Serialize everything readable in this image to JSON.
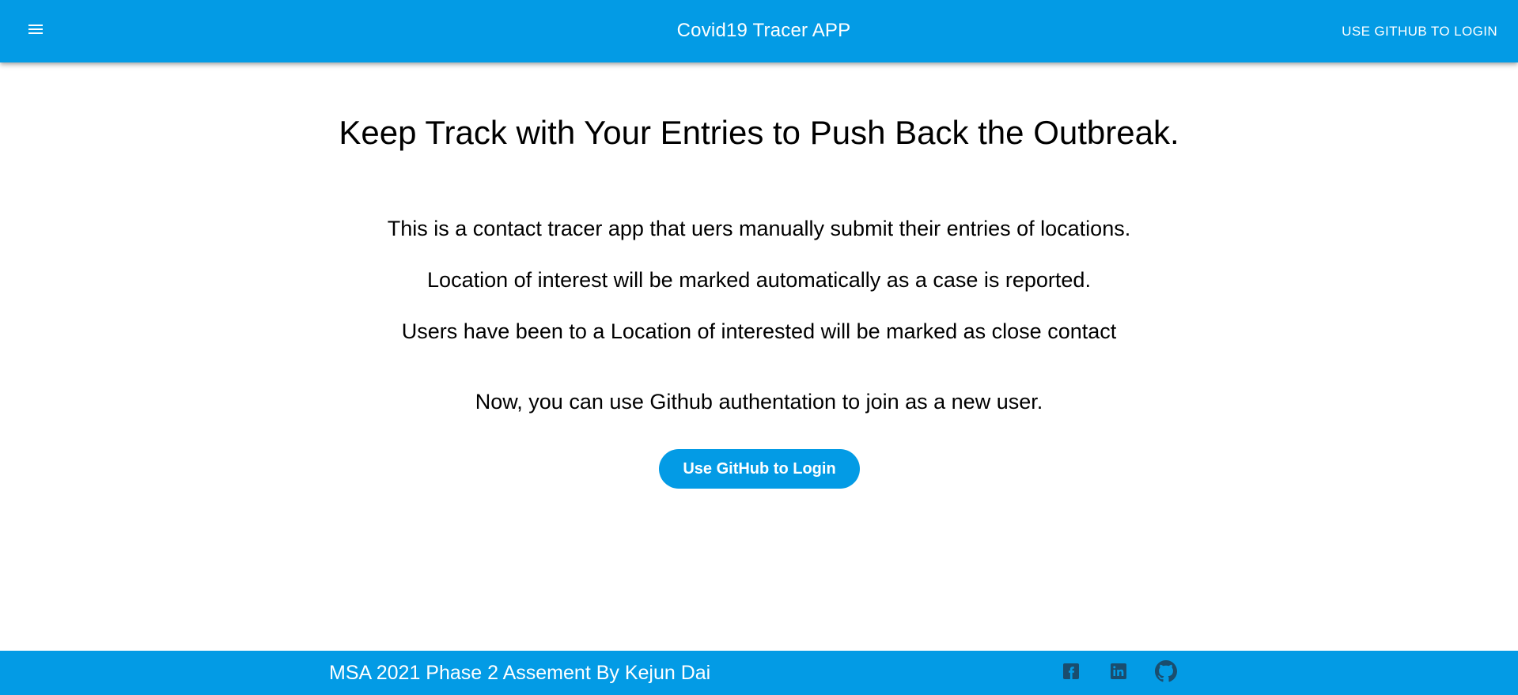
{
  "header": {
    "title": "Covid19 Tracer APP",
    "login_label": "USE GITHUB TO LOGIN"
  },
  "main": {
    "heading": "Keep Track with Your Entries to Push Back the Outbreak.",
    "paragraphs": [
      "This is a contact tracer app that uers manually submit their entries of locations.",
      "Location of interest will be marked automatically as a case is reported.",
      "Users have been to a Location of interested will be marked as close contact",
      "Now, you can use Github authentation to join as a new user."
    ],
    "login_button_label": "Use GitHub to Login"
  },
  "footer": {
    "text": "MSA 2021 Phase 2 Assement By Kejun Dai",
    "icons": [
      "facebook-icon",
      "linkedin-icon",
      "github-icon"
    ]
  },
  "colors": {
    "primary": "#039be5",
    "footer_icon": "#1a4d6e",
    "text": "#000000",
    "on_primary": "#ffffff"
  }
}
